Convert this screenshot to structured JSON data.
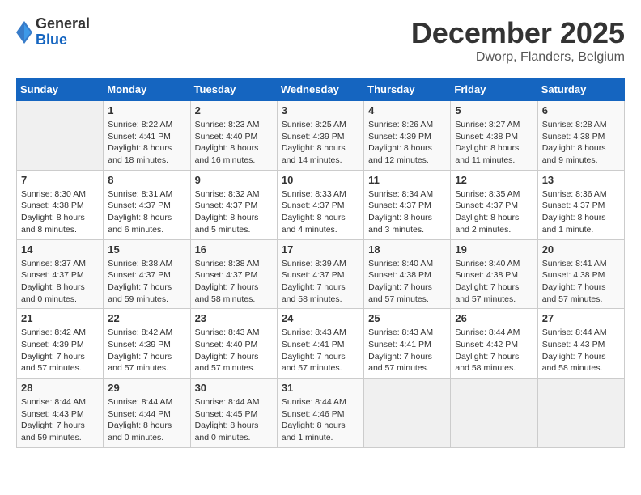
{
  "header": {
    "logo_general": "General",
    "logo_blue": "Blue",
    "month_title": "December 2025",
    "location": "Dworp, Flanders, Belgium"
  },
  "days_of_week": [
    "Sunday",
    "Monday",
    "Tuesday",
    "Wednesday",
    "Thursday",
    "Friday",
    "Saturday"
  ],
  "weeks": [
    [
      {
        "day": "",
        "sunrise": "",
        "sunset": "",
        "daylight": ""
      },
      {
        "day": "1",
        "sunrise": "Sunrise: 8:22 AM",
        "sunset": "Sunset: 4:41 PM",
        "daylight": "Daylight: 8 hours and 18 minutes."
      },
      {
        "day": "2",
        "sunrise": "Sunrise: 8:23 AM",
        "sunset": "Sunset: 4:40 PM",
        "daylight": "Daylight: 8 hours and 16 minutes."
      },
      {
        "day": "3",
        "sunrise": "Sunrise: 8:25 AM",
        "sunset": "Sunset: 4:39 PM",
        "daylight": "Daylight: 8 hours and 14 minutes."
      },
      {
        "day": "4",
        "sunrise": "Sunrise: 8:26 AM",
        "sunset": "Sunset: 4:39 PM",
        "daylight": "Daylight: 8 hours and 12 minutes."
      },
      {
        "day": "5",
        "sunrise": "Sunrise: 8:27 AM",
        "sunset": "Sunset: 4:38 PM",
        "daylight": "Daylight: 8 hours and 11 minutes."
      },
      {
        "day": "6",
        "sunrise": "Sunrise: 8:28 AM",
        "sunset": "Sunset: 4:38 PM",
        "daylight": "Daylight: 8 hours and 9 minutes."
      }
    ],
    [
      {
        "day": "7",
        "sunrise": "Sunrise: 8:30 AM",
        "sunset": "Sunset: 4:38 PM",
        "daylight": "Daylight: 8 hours and 8 minutes."
      },
      {
        "day": "8",
        "sunrise": "Sunrise: 8:31 AM",
        "sunset": "Sunset: 4:37 PM",
        "daylight": "Daylight: 8 hours and 6 minutes."
      },
      {
        "day": "9",
        "sunrise": "Sunrise: 8:32 AM",
        "sunset": "Sunset: 4:37 PM",
        "daylight": "Daylight: 8 hours and 5 minutes."
      },
      {
        "day": "10",
        "sunrise": "Sunrise: 8:33 AM",
        "sunset": "Sunset: 4:37 PM",
        "daylight": "Daylight: 8 hours and 4 minutes."
      },
      {
        "day": "11",
        "sunrise": "Sunrise: 8:34 AM",
        "sunset": "Sunset: 4:37 PM",
        "daylight": "Daylight: 8 hours and 3 minutes."
      },
      {
        "day": "12",
        "sunrise": "Sunrise: 8:35 AM",
        "sunset": "Sunset: 4:37 PM",
        "daylight": "Daylight: 8 hours and 2 minutes."
      },
      {
        "day": "13",
        "sunrise": "Sunrise: 8:36 AM",
        "sunset": "Sunset: 4:37 PM",
        "daylight": "Daylight: 8 hours and 1 minute."
      }
    ],
    [
      {
        "day": "14",
        "sunrise": "Sunrise: 8:37 AM",
        "sunset": "Sunset: 4:37 PM",
        "daylight": "Daylight: 8 hours and 0 minutes."
      },
      {
        "day": "15",
        "sunrise": "Sunrise: 8:38 AM",
        "sunset": "Sunset: 4:37 PM",
        "daylight": "Daylight: 7 hours and 59 minutes."
      },
      {
        "day": "16",
        "sunrise": "Sunrise: 8:38 AM",
        "sunset": "Sunset: 4:37 PM",
        "daylight": "Daylight: 7 hours and 58 minutes."
      },
      {
        "day": "17",
        "sunrise": "Sunrise: 8:39 AM",
        "sunset": "Sunset: 4:37 PM",
        "daylight": "Daylight: 7 hours and 58 minutes."
      },
      {
        "day": "18",
        "sunrise": "Sunrise: 8:40 AM",
        "sunset": "Sunset: 4:38 PM",
        "daylight": "Daylight: 7 hours and 57 minutes."
      },
      {
        "day": "19",
        "sunrise": "Sunrise: 8:40 AM",
        "sunset": "Sunset: 4:38 PM",
        "daylight": "Daylight: 7 hours and 57 minutes."
      },
      {
        "day": "20",
        "sunrise": "Sunrise: 8:41 AM",
        "sunset": "Sunset: 4:38 PM",
        "daylight": "Daylight: 7 hours and 57 minutes."
      }
    ],
    [
      {
        "day": "21",
        "sunrise": "Sunrise: 8:42 AM",
        "sunset": "Sunset: 4:39 PM",
        "daylight": "Daylight: 7 hours and 57 minutes."
      },
      {
        "day": "22",
        "sunrise": "Sunrise: 8:42 AM",
        "sunset": "Sunset: 4:39 PM",
        "daylight": "Daylight: 7 hours and 57 minutes."
      },
      {
        "day": "23",
        "sunrise": "Sunrise: 8:43 AM",
        "sunset": "Sunset: 4:40 PM",
        "daylight": "Daylight: 7 hours and 57 minutes."
      },
      {
        "day": "24",
        "sunrise": "Sunrise: 8:43 AM",
        "sunset": "Sunset: 4:41 PM",
        "daylight": "Daylight: 7 hours and 57 minutes."
      },
      {
        "day": "25",
        "sunrise": "Sunrise: 8:43 AM",
        "sunset": "Sunset: 4:41 PM",
        "daylight": "Daylight: 7 hours and 57 minutes."
      },
      {
        "day": "26",
        "sunrise": "Sunrise: 8:44 AM",
        "sunset": "Sunset: 4:42 PM",
        "daylight": "Daylight: 7 hours and 58 minutes."
      },
      {
        "day": "27",
        "sunrise": "Sunrise: 8:44 AM",
        "sunset": "Sunset: 4:43 PM",
        "daylight": "Daylight: 7 hours and 58 minutes."
      }
    ],
    [
      {
        "day": "28",
        "sunrise": "Sunrise: 8:44 AM",
        "sunset": "Sunset: 4:43 PM",
        "daylight": "Daylight: 7 hours and 59 minutes."
      },
      {
        "day": "29",
        "sunrise": "Sunrise: 8:44 AM",
        "sunset": "Sunset: 4:44 PM",
        "daylight": "Daylight: 8 hours and 0 minutes."
      },
      {
        "day": "30",
        "sunrise": "Sunrise: 8:44 AM",
        "sunset": "Sunset: 4:45 PM",
        "daylight": "Daylight: 8 hours and 0 minutes."
      },
      {
        "day": "31",
        "sunrise": "Sunrise: 8:44 AM",
        "sunset": "Sunset: 4:46 PM",
        "daylight": "Daylight: 8 hours and 1 minute."
      },
      {
        "day": "",
        "sunrise": "",
        "sunset": "",
        "daylight": ""
      },
      {
        "day": "",
        "sunrise": "",
        "sunset": "",
        "daylight": ""
      },
      {
        "day": "",
        "sunrise": "",
        "sunset": "",
        "daylight": ""
      }
    ]
  ]
}
